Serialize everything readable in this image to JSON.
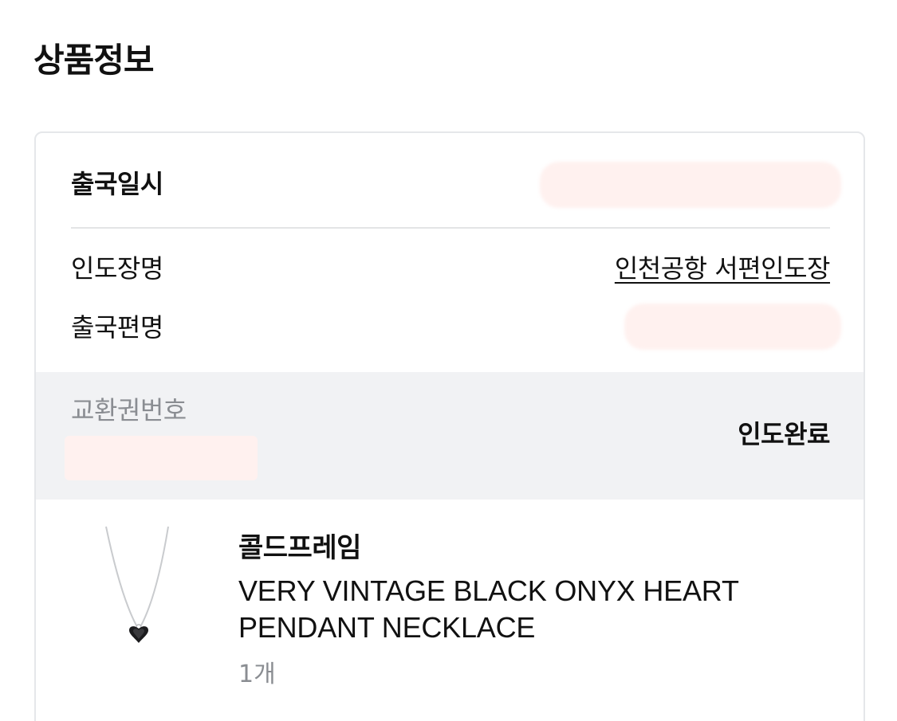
{
  "section_title": "상품정보",
  "departure": {
    "label": "출국일시"
  },
  "pickup_place": {
    "label": "인도장명",
    "value": "인천공항 서편인도장"
  },
  "flight": {
    "label": "출국편명"
  },
  "voucher": {
    "label": "교환권번호",
    "status": "인도완료"
  },
  "product": {
    "brand": "콜드프레임",
    "name": "VERY VINTAGE BLACK ONYX HEART PENDANT NECKLACE",
    "quantity": "1개",
    "image_icon": "necklace-pendant-icon"
  },
  "colors": {
    "band_bg": "#f1f2f4",
    "muted_text": "#8a8d92",
    "redaction": "#fff1ef",
    "border": "#e5e7ea"
  }
}
